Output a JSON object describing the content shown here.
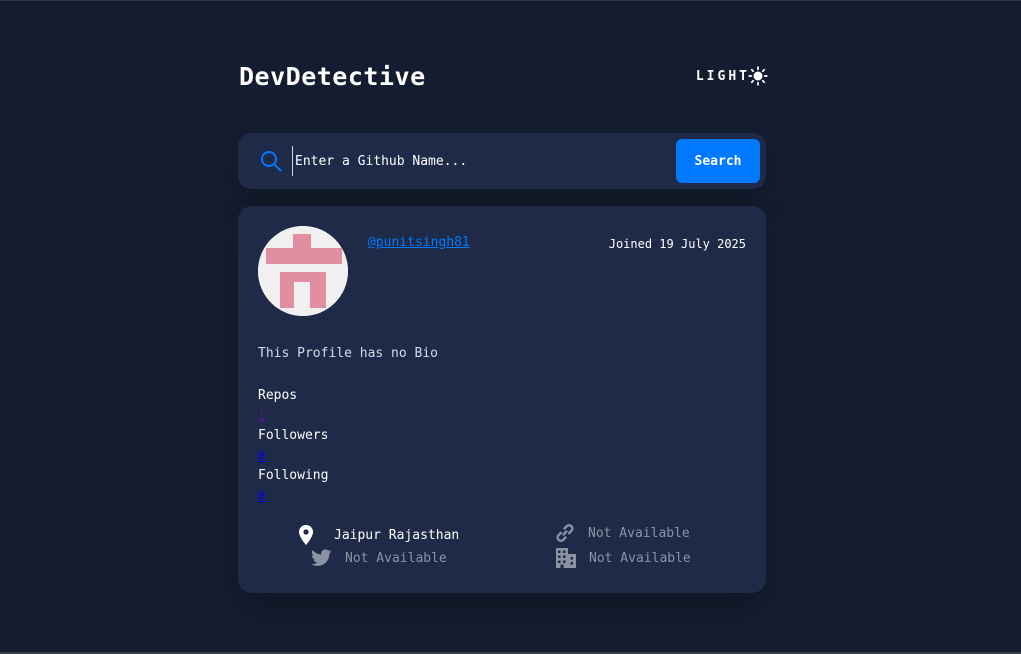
{
  "header": {
    "title": "DevDetective",
    "mode_label": "LIGHT"
  },
  "search": {
    "placeholder": "Enter a Github Name...",
    "value": "",
    "button_label": "Search"
  },
  "profile": {
    "username": "@punitsingh81",
    "joined": "Joined 19 July 2025",
    "bio": "This Profile has no Bio",
    "avatar_color": "#e08ea0",
    "stats": [
      {
        "label": "Repos",
        "value": "1"
      },
      {
        "label": "Followers",
        "value": "0"
      },
      {
        "label": "Following",
        "value": "0"
      }
    ],
    "links": {
      "location": "Jaipur Rajasthan",
      "website": "Not Available",
      "twitter": "Not Available",
      "company": "Not Available"
    }
  },
  "icons": {
    "theme": "sun-icon",
    "search": "search-icon",
    "location": "location-pin-icon",
    "website": "link-icon",
    "twitter": "twitter-icon",
    "company": "building-icon"
  },
  "colors": {
    "background": "#141d2f",
    "card": "#1e2a47",
    "accent": "#0079ff",
    "muted_text": "#8b93a3"
  }
}
